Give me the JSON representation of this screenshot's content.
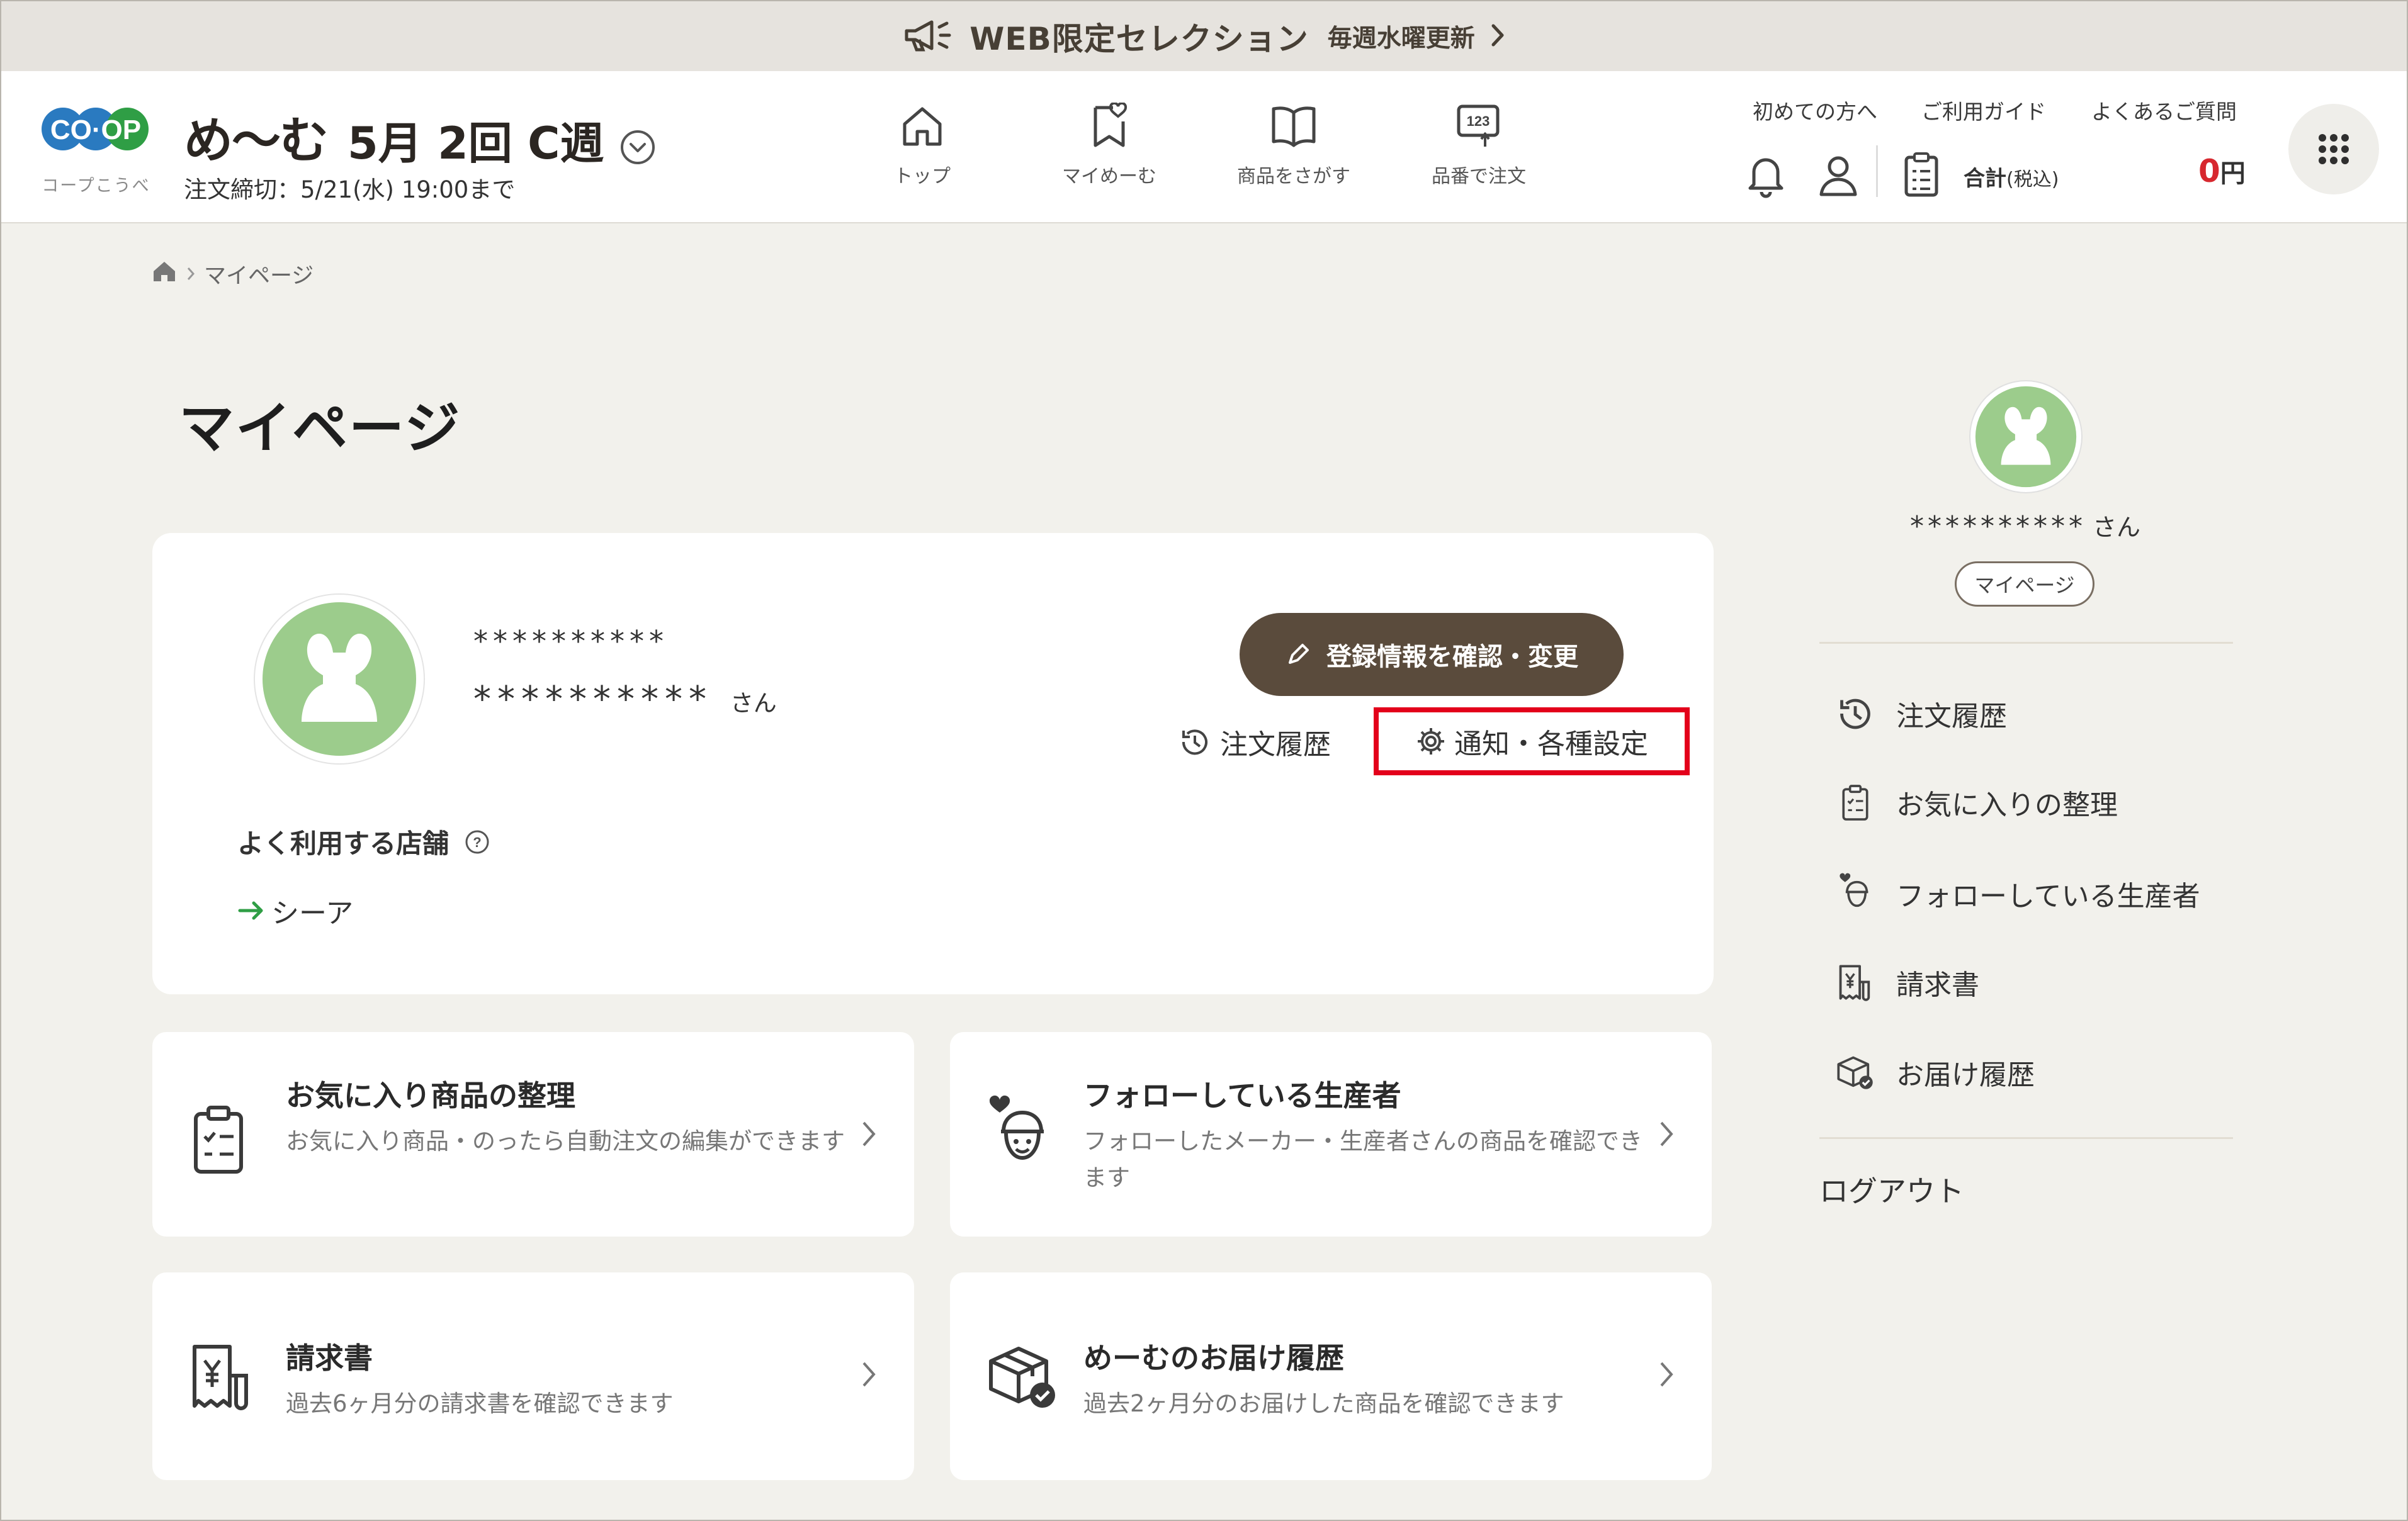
{
  "banner": {
    "title": "WEB限定セレクション",
    "subtitle": "毎週水曜更新",
    "icon": "megaphone-icon"
  },
  "header": {
    "logo_text": "CO·OP",
    "logo_sub": "コープこうべ",
    "brand": "め～む",
    "week": "5月 2回 C週",
    "deadline": "注文締切：5/21(水) 19:00まで",
    "nav": [
      {
        "label": "トップ",
        "icon": "home-icon"
      },
      {
        "label": "マイめーむ",
        "icon": "bookmark-heart-icon"
      },
      {
        "label": "商品をさがす",
        "icon": "book-icon"
      },
      {
        "label": "品番で注文",
        "icon": "number-order-icon"
      }
    ],
    "links": [
      "初めての方へ",
      "ご利用ガイド",
      "よくあるご質問"
    ],
    "cart_label": "合計",
    "cart_tax": "(税込)",
    "cart_total": "0",
    "cart_unit": "円"
  },
  "breadcrumb": {
    "current": "マイページ"
  },
  "page_title": "マイページ",
  "profile": {
    "masked_id": "**********",
    "masked_name": "**********",
    "honorific": "さん",
    "edit_button": "登録情報を確認・変更",
    "history_link": "注文履歴",
    "settings_link": "通知・各種設定",
    "store_title": "よく利用する店舗",
    "store_name": "シーア"
  },
  "tiles": [
    {
      "title": "お気に入り商品の整理",
      "desc": "お気に入り商品・のったら自動注文の編集ができます",
      "icon": "clipboard-list-icon"
    },
    {
      "title": "フォローしている生産者",
      "desc": "フォローしたメーカー・生産者さんの商品を確認できます",
      "icon": "producer-heart-icon"
    },
    {
      "title": "請求書",
      "desc": "過去6ヶ月分の請求書を確認できます",
      "icon": "invoice-yen-icon"
    },
    {
      "title": "めーむのお届け履歴",
      "desc": "過去2ヶ月分のお届けした商品を確認できます",
      "icon": "delivery-box-icon"
    }
  ],
  "sidebar": {
    "name": "**********",
    "honorific": "さん",
    "mypage_button": "マイページ",
    "items": [
      {
        "label": "注文履歴",
        "icon": "history-icon"
      },
      {
        "label": "お気に入りの整理",
        "icon": "clipboard-list-icon"
      },
      {
        "label": "フォローしている生産者",
        "icon": "producer-heart-icon"
      },
      {
        "label": "請求書",
        "icon": "invoice-yen-icon"
      },
      {
        "label": "お届け履歴",
        "icon": "delivery-box-icon"
      }
    ],
    "logout": "ログアウト"
  },
  "colors": {
    "accent_brown": "#5a4b3c",
    "highlight_red": "#e3001b",
    "price_red": "#d7282f",
    "logo_blue": "#2a7ac0",
    "logo_green": "#2f9e45",
    "avatar_green": "#9ccc8c"
  }
}
